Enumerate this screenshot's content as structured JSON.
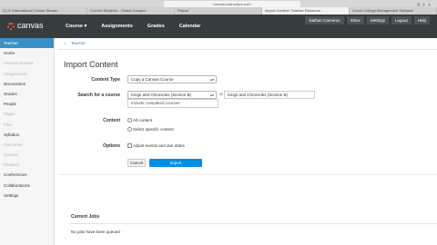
{
  "browser": {
    "url": "canvas.instructure.com",
    "tabs": [
      "(1) 2: International | Home Stream",
      "Current Students - Global Campus",
      "Piazza",
      "Import Content: Teacher Resource",
      "Lenoir College Management Software"
    ],
    "active_tab_index": 3
  },
  "nav": {
    "logo_text": "canvas",
    "items": [
      "Course ▾",
      "Assignments",
      "Grades",
      "Calendar"
    ],
    "user_links": [
      "Nathan Cameron",
      "Inbox",
      "Settings",
      "Logout",
      "Help"
    ]
  },
  "sidebar": {
    "items": [
      {
        "label": "Teacher",
        "state": "active"
      },
      {
        "label": "Home",
        "state": "normal"
      },
      {
        "label": "Announcements",
        "state": "dim"
      },
      {
        "label": "Assignments",
        "state": "dim"
      },
      {
        "label": "Discussions",
        "state": "normal"
      },
      {
        "label": "Grades",
        "state": "normal"
      },
      {
        "label": "People",
        "state": "normal"
      },
      {
        "label": "Pages",
        "state": "dim"
      },
      {
        "label": "Files",
        "state": "dim"
      },
      {
        "label": "Syllabus",
        "state": "normal"
      },
      {
        "label": "Outcomes",
        "state": "dim"
      },
      {
        "label": "Quizzes",
        "state": "dim"
      },
      {
        "label": "Modules",
        "state": "dim"
      },
      {
        "label": "Conferences",
        "state": "normal"
      },
      {
        "label": "Collaborations",
        "state": "normal"
      },
      {
        "label": "Settings",
        "state": "normal"
      }
    ]
  },
  "breadcrumb": {
    "crumb": "Teacher"
  },
  "page": {
    "title": "Import Content",
    "content_type_label": "Content Type",
    "content_type_value": "Copy a Canvas Course",
    "search_label": "Search for a course",
    "search_value": "Kings and Chronicles (Section B)",
    "or_text": "or",
    "course_box": "Kings and Chronicles (Section B)",
    "include_completed": "Include completed courses",
    "content_label": "Content",
    "content_all": "All content",
    "content_specific": "Select specific content",
    "options_label": "Options",
    "options_adjust": "Adjust events and due dates",
    "cancel_label": "Cancel",
    "import_label": "Import",
    "current_jobs_title": "Current Jobs",
    "jobs_empty": "No jobs have been queued"
  },
  "colors": {
    "nav_bg": "#373d3f",
    "primary": "#008ee2",
    "sidebar_active": "#3b8fc7",
    "logo": "#e66135"
  }
}
